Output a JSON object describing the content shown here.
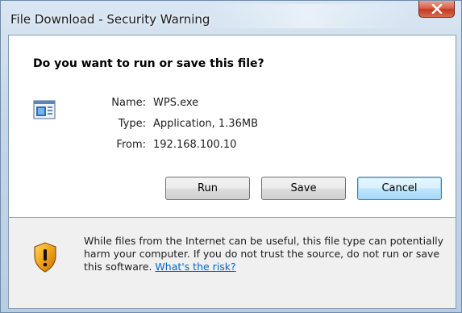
{
  "window": {
    "title": "File Download - Security Warning",
    "close_label": "X"
  },
  "dialog": {
    "question": "Do you want to run or save this file?",
    "file": {
      "name_label": "Name:",
      "name_value": "WPS.exe",
      "type_label": "Type:",
      "type_value": "Application, 1.36MB",
      "from_label": "From:",
      "from_value": "192.168.100.10"
    },
    "buttons": {
      "run": "Run",
      "save": "Save",
      "cancel": "Cancel"
    }
  },
  "footer": {
    "warning_text": "While files from the Internet can be useful, this file type can potentially harm your computer. If you do not trust the source, do not run or save this software.",
    "risk_link": "What's the risk?"
  },
  "icons": {
    "file": "application-file-icon",
    "shield": "security-shield-warning-icon",
    "close": "close-icon"
  },
  "colors": {
    "link": "#0066cc",
    "close_button": "#c33a22",
    "default_button_border": "#3c7fb1"
  }
}
